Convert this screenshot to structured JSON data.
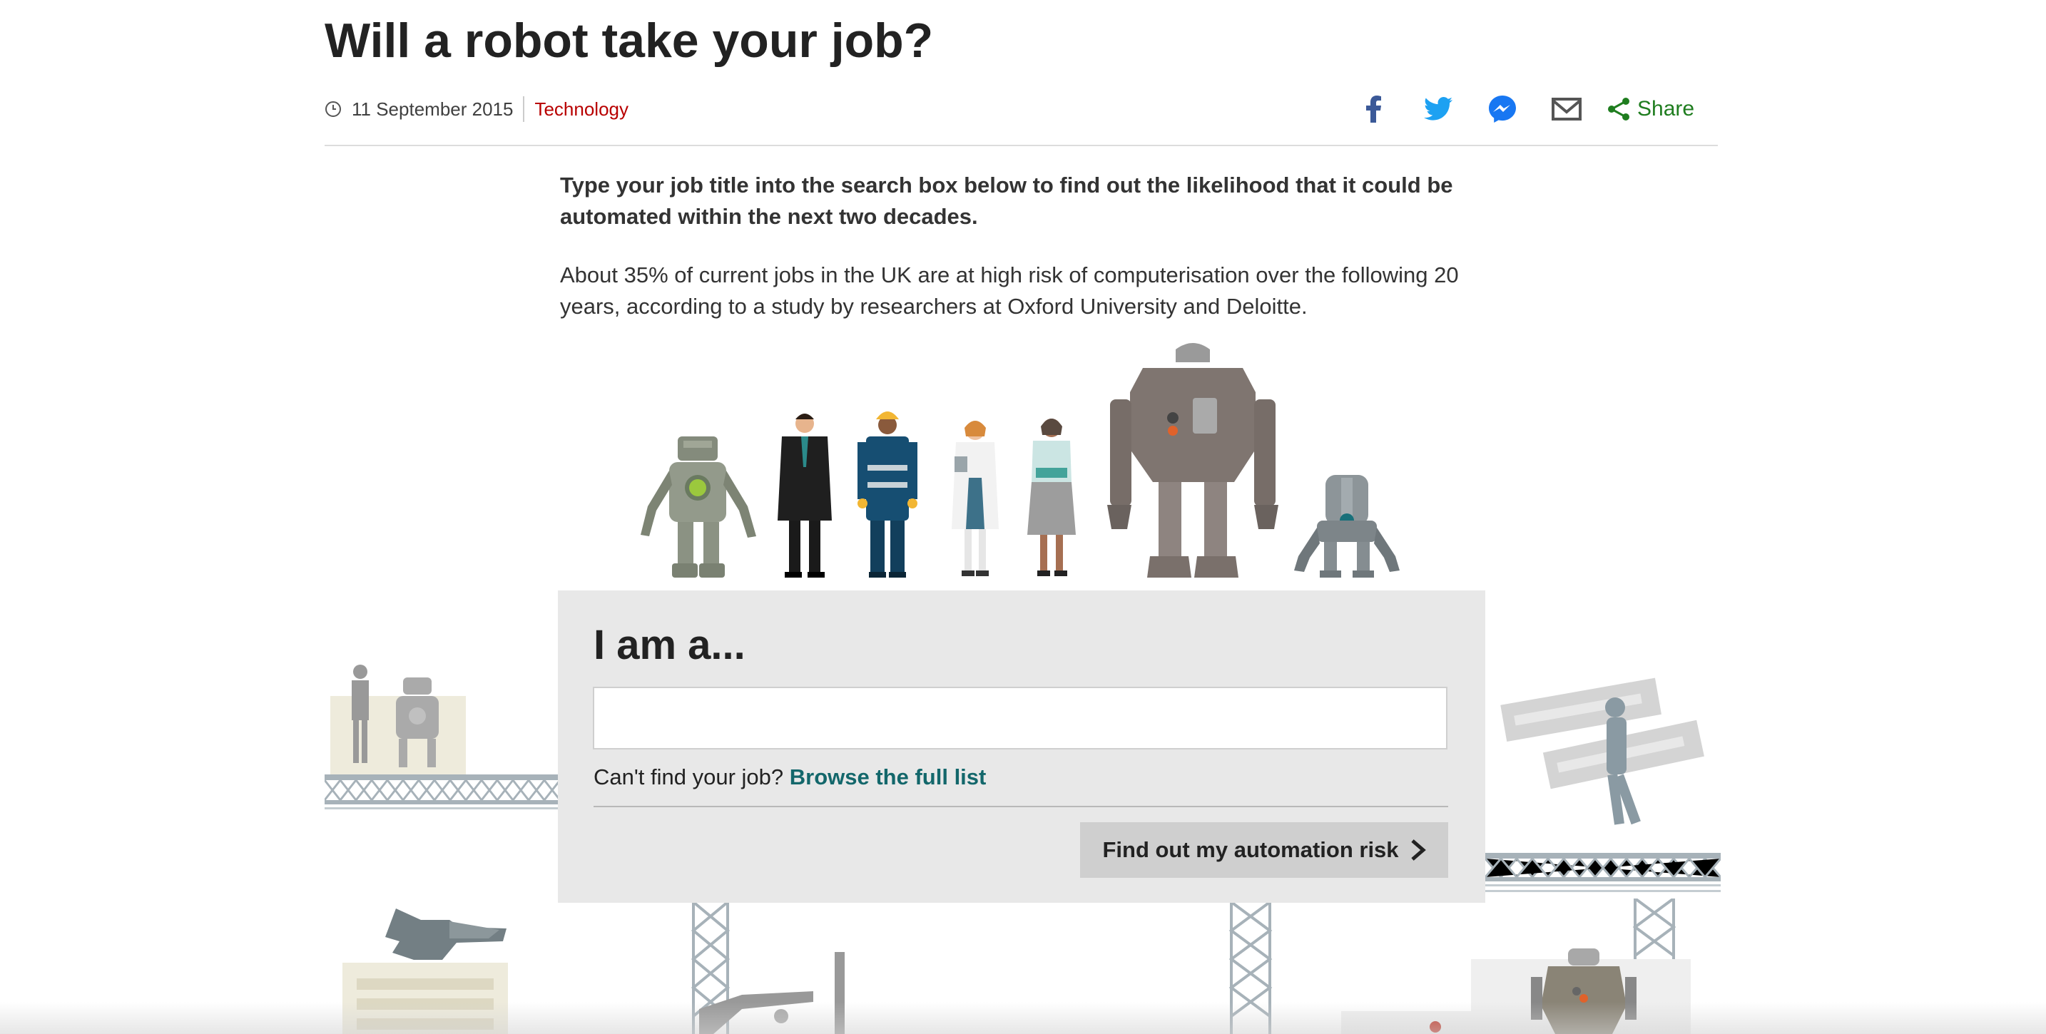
{
  "article": {
    "title": "Will a robot take your job?",
    "date": "11 September 2015",
    "section": "Technology",
    "share_label": "Share",
    "share_icons": [
      "facebook-icon",
      "twitter-icon",
      "messenger-icon",
      "email-icon",
      "share-icon"
    ],
    "intro": "Type your job title into the search box below to find out the likelihood that it could be automated within the next two decades.",
    "body": "About 35% of current jobs in the UK are at high risk of computerisation over the following 20 years, according to a study by researchers at Oxford University and Deloitte."
  },
  "tool": {
    "heading": "I am a...",
    "input_value": "",
    "input_placeholder": "",
    "cant_find_text": "Can't find your job?",
    "browse_link": "Browse the full list",
    "submit_label": "Find out my automation risk"
  },
  "colors": {
    "section_link": "#b80000",
    "share_green": "#1f7d1f",
    "browse_link": "#13676b",
    "facebook": "#3b5998",
    "twitter": "#1da1f2",
    "messenger": "#1877f2",
    "panel_bg": "#e8e8e8",
    "button_bg": "#cfcfcf"
  }
}
